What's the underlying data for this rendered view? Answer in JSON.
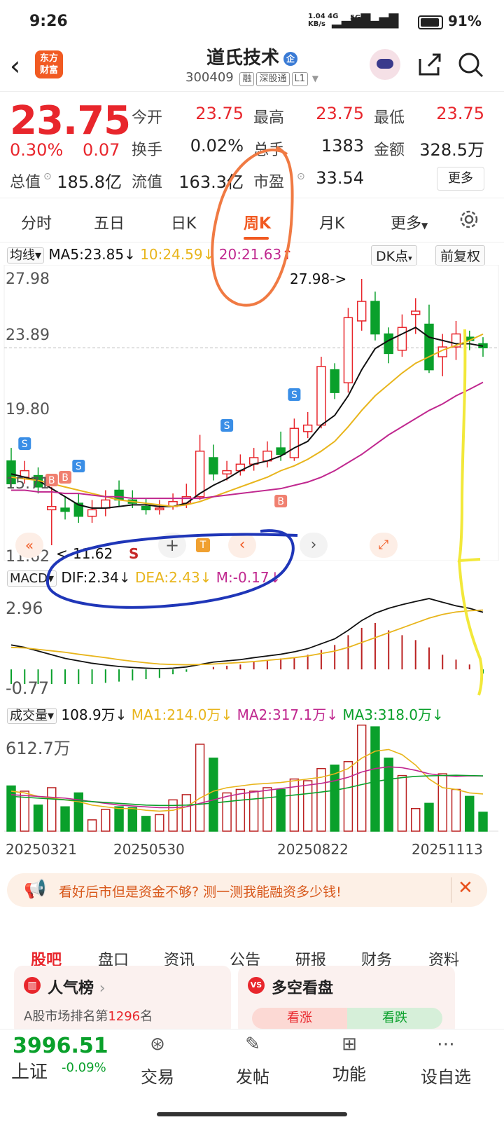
{
  "status": {
    "time": "9:26",
    "net_speed": "1.04",
    "net_unit": "KB/s",
    "net_type": "4G",
    "net_type2": "5G",
    "battery": "91%"
  },
  "header": {
    "logo_line1": "东方",
    "logo_line2": "财富",
    "title": "道氏技术",
    "title_badge": "企",
    "code": "300409",
    "tags": [
      "融",
      "深股通",
      "L1"
    ]
  },
  "quote": {
    "price": "23.75",
    "change_pct": "0.30%",
    "change": "0.07",
    "rows": [
      [
        {
          "label": "今开",
          "value": "23.75",
          "red": true
        },
        {
          "label": "最高",
          "value": "23.75",
          "red": true
        },
        {
          "label": "最低",
          "value": "23.75",
          "red": true
        }
      ],
      [
        {
          "label": "换手",
          "value": "0.02%",
          "red": false
        },
        {
          "label": "总手",
          "value": "1383",
          "red": false
        },
        {
          "label": "金额",
          "value": "328.5万",
          "red": false
        }
      ],
      [
        {
          "label": "总值",
          "value": "185.8亿",
          "red": false
        },
        {
          "label": "流值",
          "value": "163.3亿",
          "red": false
        },
        {
          "label": "市盈",
          "value": "33.54",
          "red": false
        }
      ]
    ],
    "more": "更多"
  },
  "tabs": [
    "分时",
    "五日",
    "日K",
    "周K",
    "月K",
    "更多"
  ],
  "kline_header": {
    "type": "均线",
    "ma5": "MA5:23.85",
    "ma10": "10:24.59",
    "ma20": "20:21.63",
    "dk": "DK点",
    "fq": "前复权"
  },
  "kline_axis": [
    "27.98",
    "23.89",
    "19.80",
    "15.71",
    "11.62"
  ],
  "kline_annotations": {
    "high": "27.98->",
    "low": "<-11.62"
  },
  "chart_controls": {
    "t_badge": "T",
    "s_label": "S"
  },
  "macd_header": {
    "type": "MACD",
    "dif": "DIF:2.34",
    "dea": "DEA:2.43",
    "m": "M:-0.17"
  },
  "macd_axis": [
    "2.96",
    "-0.77"
  ],
  "vol_header": {
    "type": "成交量",
    "vol": "108.9万",
    "ma1": "MA1:214.0万",
    "ma2": "MA2:317.1万",
    "ma3": "MA3:318.0万"
  },
  "vol_axis": [
    "612.7万"
  ],
  "dates": [
    "20250321",
    "20250530",
    "20250822",
    "20251113"
  ],
  "colors": {
    "up": "#e8262c",
    "down": "#0aa02b",
    "ma5": "#111111",
    "ma10": "#e8b51c",
    "ma20": "#c0288f",
    "accent": "#f15a22"
  },
  "banner": {
    "text": "看好后市但是资金不够? 测一测我能融资多少钱!"
  },
  "bottom_tabs": [
    "股吧",
    "盘口",
    "资讯",
    "公告",
    "研报",
    "财务",
    "资料"
  ],
  "cards": [
    {
      "title": "人气榜",
      "sub_prefix": "A股市场排名第",
      "rank": "1296",
      "sub_suffix": "名"
    },
    {
      "title": "多空看盘",
      "rise": "看涨",
      "fall": "看跌"
    }
  ],
  "bottom_bar": {
    "index_value": "3996.51",
    "index_name": "上证",
    "index_change": "-0.09%",
    "items": [
      "交易",
      "发帖",
      "功能",
      "设自选"
    ]
  },
  "chart_data": {
    "type": "candlestick",
    "ylim": [
      11.62,
      27.98
    ],
    "candles": [
      {
        "o": 16.8,
        "c": 15.4,
        "h": 17.6,
        "l": 15.1
      },
      {
        "o": 15.8,
        "c": 16.2,
        "h": 16.8,
        "l": 15.4
      },
      {
        "o": 15.9,
        "c": 15.2,
        "h": 16.4,
        "l": 14.8
      },
      {
        "o": 13.8,
        "c": 14.0,
        "h": 15.2,
        "l": 11.62
      },
      {
        "o": 13.9,
        "c": 13.7,
        "h": 14.6,
        "l": 13.2
      },
      {
        "o": 14.2,
        "c": 13.4,
        "h": 14.8,
        "l": 13.0
      },
      {
        "o": 13.4,
        "c": 13.8,
        "h": 14.4,
        "l": 13.0
      },
      {
        "o": 13.9,
        "c": 14.4,
        "h": 15.0,
        "l": 13.4
      },
      {
        "o": 15.0,
        "c": 14.4,
        "h": 15.6,
        "l": 14.0
      },
      {
        "o": 14.4,
        "c": 14.2,
        "h": 15.0,
        "l": 13.9
      },
      {
        "o": 14.0,
        "c": 13.8,
        "h": 14.5,
        "l": 13.5
      },
      {
        "o": 13.8,
        "c": 13.9,
        "h": 14.4,
        "l": 13.5
      },
      {
        "o": 14.0,
        "c": 14.3,
        "h": 14.8,
        "l": 13.8
      },
      {
        "o": 14.2,
        "c": 14.6,
        "h": 15.4,
        "l": 13.9
      },
      {
        "o": 14.6,
        "c": 17.4,
        "h": 18.4,
        "l": 14.4
      },
      {
        "o": 17.0,
        "c": 16.0,
        "h": 17.8,
        "l": 15.6
      },
      {
        "o": 16.0,
        "c": 16.2,
        "h": 16.8,
        "l": 15.6
      },
      {
        "o": 16.2,
        "c": 16.6,
        "h": 17.2,
        "l": 15.9
      },
      {
        "o": 16.6,
        "c": 17.0,
        "h": 17.6,
        "l": 16.2
      },
      {
        "o": 16.8,
        "c": 17.4,
        "h": 18.0,
        "l": 16.4
      },
      {
        "o": 17.6,
        "c": 17.2,
        "h": 18.6,
        "l": 16.8
      },
      {
        "o": 17.0,
        "c": 18.8,
        "h": 19.4,
        "l": 16.8
      },
      {
        "o": 18.6,
        "c": 19.0,
        "h": 19.8,
        "l": 18.2
      },
      {
        "o": 19.0,
        "c": 22.6,
        "h": 23.2,
        "l": 18.8
      },
      {
        "o": 22.4,
        "c": 21.0,
        "h": 22.8,
        "l": 20.6
      },
      {
        "o": 21.6,
        "c": 25.6,
        "h": 26.2,
        "l": 21.0
      },
      {
        "o": 25.4,
        "c": 26.6,
        "h": 27.98,
        "l": 24.8
      },
      {
        "o": 26.6,
        "c": 24.6,
        "h": 27.2,
        "l": 24.2
      },
      {
        "o": 24.6,
        "c": 23.4,
        "h": 25.0,
        "l": 22.8
      },
      {
        "o": 23.6,
        "c": 25.0,
        "h": 25.8,
        "l": 23.2
      },
      {
        "o": 25.8,
        "c": 26.0,
        "h": 26.8,
        "l": 24.6
      },
      {
        "o": 25.2,
        "c": 22.4,
        "h": 26.4,
        "l": 22.2
      },
      {
        "o": 23.2,
        "c": 23.8,
        "h": 24.6,
        "l": 22.0
      },
      {
        "o": 23.8,
        "c": 24.6,
        "h": 25.4,
        "l": 23.0
      },
      {
        "o": 24.4,
        "c": 24.2,
        "h": 24.8,
        "l": 23.6
      },
      {
        "o": 24.0,
        "c": 23.75,
        "h": 24.4,
        "l": 23.2
      }
    ],
    "ma5": [
      16.0,
      15.8,
      15.6,
      15.1,
      14.6,
      14.1,
      13.9,
      13.9,
      14.0,
      14.1,
      14.1,
      14.0,
      14.0,
      14.2,
      14.8,
      15.3,
      15.7,
      16.2,
      16.6,
      16.8,
      17.1,
      17.6,
      18.0,
      19.0,
      19.6,
      20.8,
      22.4,
      23.7,
      24.2,
      24.6,
      25.0,
      24.4,
      24.2,
      24.0,
      24.0,
      23.85
    ],
    "ma10": [
      15.8,
      15.7,
      15.6,
      15.4,
      15.2,
      15.0,
      14.8,
      14.6,
      14.4,
      14.3,
      14.2,
      14.1,
      14.0,
      14.1,
      14.3,
      14.6,
      14.9,
      15.2,
      15.5,
      15.8,
      16.2,
      16.5,
      16.9,
      17.4,
      18.0,
      18.9,
      19.9,
      20.8,
      21.5,
      22.2,
      22.8,
      23.2,
      23.6,
      23.9,
      24.2,
      24.59
    ],
    "ma20": [
      15.0,
      15.0,
      14.9,
      14.9,
      14.8,
      14.8,
      14.7,
      14.6,
      14.6,
      14.5,
      14.5,
      14.5,
      14.5,
      14.5,
      14.5,
      14.6,
      14.7,
      14.8,
      14.9,
      15.0,
      15.1,
      15.3,
      15.5,
      15.8,
      16.2,
      16.7,
      17.2,
      17.8,
      18.4,
      18.9,
      19.4,
      19.9,
      20.3,
      20.8,
      21.2,
      21.63
    ],
    "macd": {
      "ylim": [
        -0.77,
        2.96
      ],
      "dif": [
        1.0,
        0.9,
        0.75,
        0.6,
        0.45,
        0.35,
        0.25,
        0.18,
        0.12,
        0.08,
        0.05,
        0.03,
        0.05,
        0.1,
        0.2,
        0.3,
        0.35,
        0.4,
        0.48,
        0.55,
        0.62,
        0.72,
        0.85,
        1.05,
        1.25,
        1.6,
        2.0,
        2.3,
        2.5,
        2.65,
        2.78,
        2.9,
        2.75,
        2.6,
        2.5,
        2.34
      ],
      "dea": [
        0.9,
        0.88,
        0.82,
        0.76,
        0.7,
        0.62,
        0.55,
        0.48,
        0.4,
        0.33,
        0.27,
        0.22,
        0.2,
        0.19,
        0.2,
        0.22,
        0.25,
        0.28,
        0.32,
        0.37,
        0.42,
        0.48,
        0.55,
        0.65,
        0.75,
        0.9,
        1.1,
        1.3,
        1.5,
        1.7,
        1.9,
        2.1,
        2.25,
        2.35,
        2.4,
        2.43
      ],
      "m": [
        -0.6,
        -0.6,
        -0.6,
        -0.6,
        -0.6,
        -0.6,
        -0.6,
        -0.55,
        -0.5,
        -0.45,
        -0.4,
        -0.35,
        -0.2,
        -0.1,
        0.0,
        0.1,
        0.15,
        0.2,
        0.3,
        0.35,
        0.45,
        0.5,
        0.6,
        0.8,
        1.0,
        1.4,
        1.7,
        1.9,
        1.6,
        1.4,
        1.2,
        0.9,
        0.6,
        0.4,
        0.2,
        -0.17
      ]
    },
    "volume": {
      "ylim": [
        0,
        612.7
      ],
      "values": [
        260,
        230,
        150,
        250,
        140,
        220,
        65,
        125,
        140,
        135,
        85,
        95,
        180,
        210,
        500,
        420,
        220,
        240,
        230,
        250,
        240,
        300,
        290,
        360,
        380,
        400,
        610,
        600,
        420,
        320,
        130,
        160,
        330,
        240,
        200,
        108.9
      ],
      "ma1": [
        230,
        220,
        200,
        190,
        180,
        170,
        150,
        140,
        130,
        130,
        120,
        115,
        120,
        140,
        190,
        230,
        250,
        260,
        270,
        275,
        280,
        290,
        300,
        310,
        330,
        360,
        420,
        460,
        470,
        440,
        380,
        300,
        250,
        240,
        220,
        214
      ],
      "ma2": [
        210,
        205,
        200,
        195,
        190,
        180,
        170,
        160,
        150,
        145,
        140,
        135,
        135,
        140,
        160,
        180,
        200,
        215,
        225,
        235,
        245,
        255,
        265,
        275,
        290,
        310,
        340,
        360,
        370,
        365,
        350,
        330,
        320,
        315,
        318,
        317.1
      ],
      "ma3": [
        200,
        195,
        190,
        185,
        180,
        175,
        170,
        165,
        160,
        155,
        150,
        148,
        148,
        150,
        155,
        162,
        170,
        178,
        185,
        192,
        200,
        208,
        216,
        225,
        235,
        250,
        268,
        285,
        298,
        308,
        315,
        318,
        320,
        322,
        320,
        318
      ]
    }
  }
}
